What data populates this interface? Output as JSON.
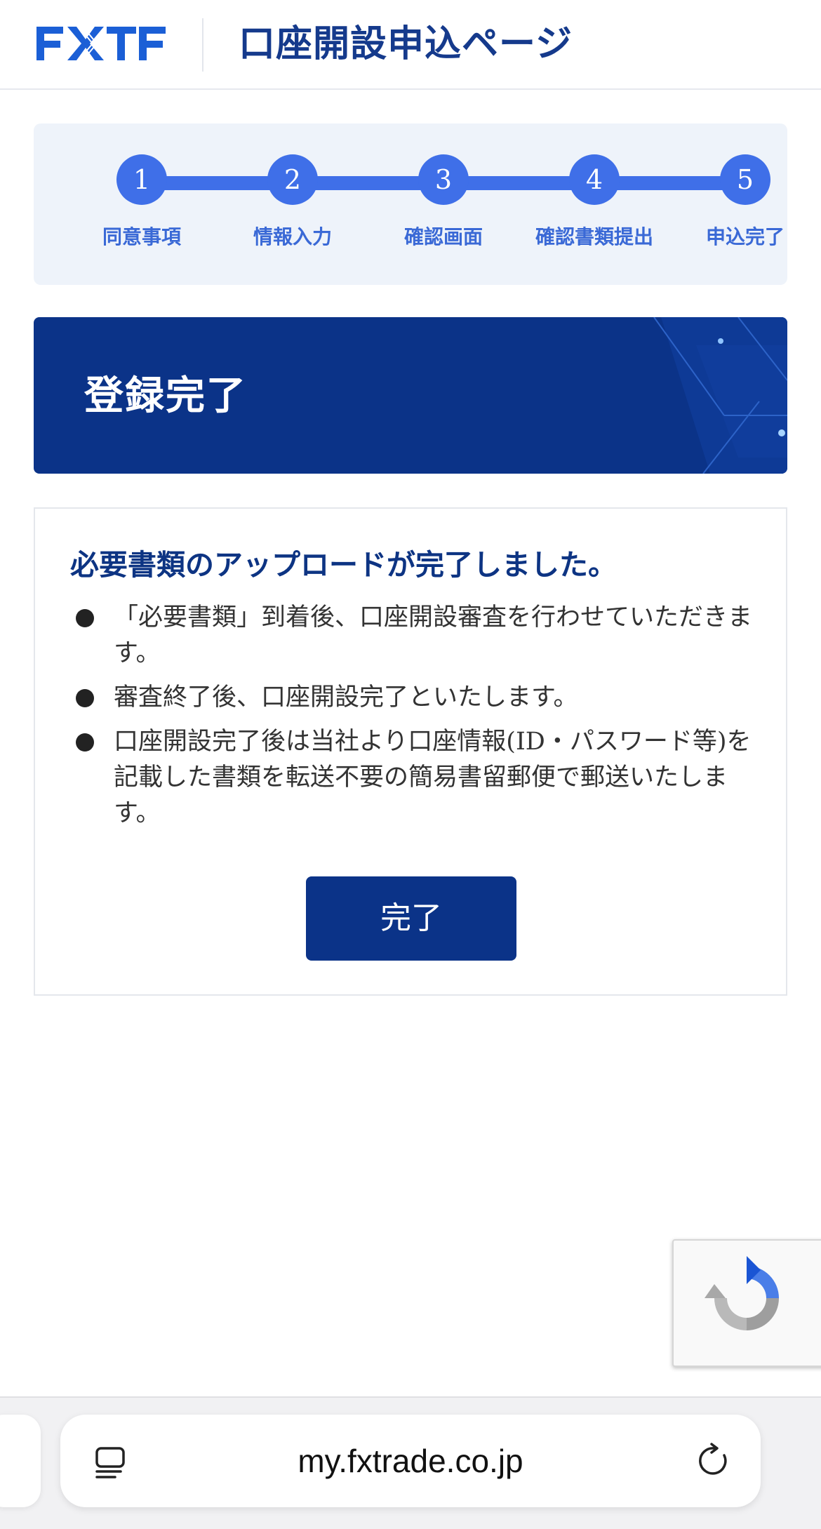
{
  "header": {
    "logo_text": "FXTF",
    "title": "口座開設申込ページ"
  },
  "stepper": {
    "steps": [
      {
        "number": "1",
        "label": "同意事項"
      },
      {
        "number": "2",
        "label": "情報入力"
      },
      {
        "number": "3",
        "label": "確認画面"
      },
      {
        "number": "4",
        "label": "確認書類提出"
      },
      {
        "number": "5",
        "label": "申込完了"
      }
    ],
    "current_step": 5
  },
  "banner": {
    "title": "登録完了"
  },
  "card": {
    "title": "必要書類のアップロードが完了しました。",
    "bullets": [
      "「必要書類」到着後、口座開設審査を行わせていただきます。",
      "審査終了後、口座開設完了といたします。",
      "口座開設完了後は当社より口座情報(ID・パスワード等)を記載した書類を転送不要の簡易書留郵便で郵送いたします。"
    ],
    "button_label": "完了"
  },
  "browser": {
    "url": "my.fxtrade.co.jp"
  },
  "colors": {
    "brand_blue": "#0b3388",
    "step_blue": "#3f6fe8",
    "stepper_bg": "#eef3fa"
  }
}
